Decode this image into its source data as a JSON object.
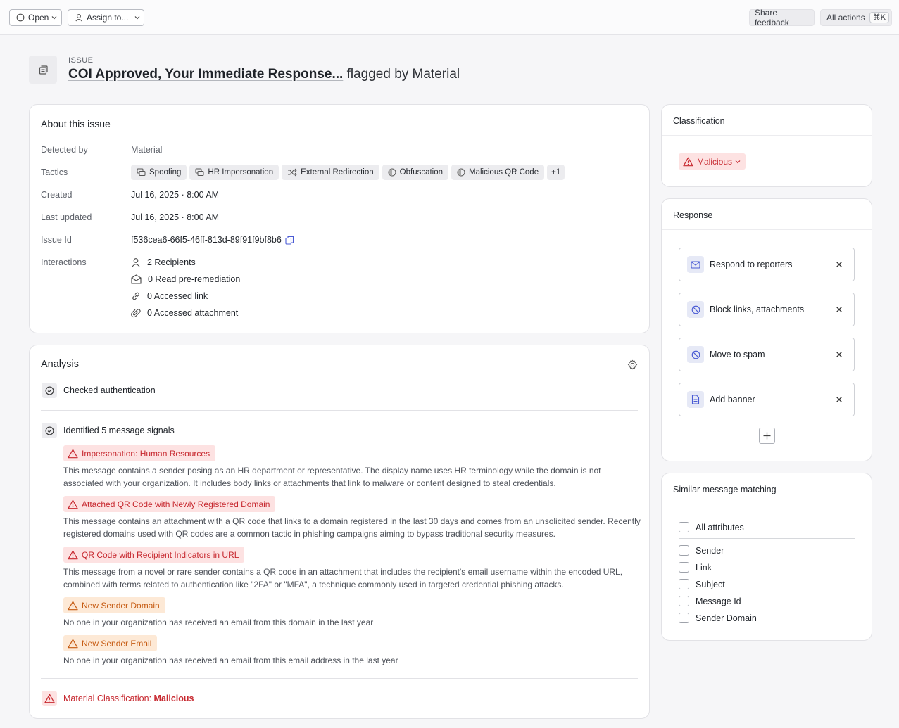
{
  "toolbar": {
    "status_label": "Open",
    "assign_label": "Assign to...",
    "share_feedback_label": "Share feedback",
    "all_actions_label": "All actions",
    "all_actions_shortcut": "⌘K"
  },
  "header": {
    "kicker": "ISSUE",
    "subject": "COI Approved, Your Immediate Response...",
    "flagged_by": "flagged by Material"
  },
  "about": {
    "title": "About this issue",
    "detected_by_label": "Detected by",
    "detected_by_value": "Material",
    "tactics_label": "Tactics",
    "tactics": [
      {
        "label": "Spoofing",
        "icon": "spoof-icon"
      },
      {
        "label": "HR Impersonation",
        "icon": "spoof-icon"
      },
      {
        "label": "External Redirection",
        "icon": "shuffle-icon"
      },
      {
        "label": "Obfuscation",
        "icon": "half-circle-icon"
      },
      {
        "label": "Malicious QR Code",
        "icon": "half-circle-icon"
      }
    ],
    "tactics_more": "+1",
    "created_label": "Created",
    "created_value": "Jul 16, 2025 · 8:00 AM",
    "updated_label": "Last updated",
    "updated_value": "Jul 16, 2025 · 8:00 AM",
    "issue_id_label": "Issue Id",
    "issue_id_value": "f536cea6-66f5-46ff-813d-89f91f9bf8b6",
    "interactions_label": "Interactions",
    "interactions": [
      {
        "label": "2 Recipients",
        "icon": "person-icon"
      },
      {
        "label": "0 Read pre-remediation",
        "icon": "envelope-open-icon"
      },
      {
        "label": "0 Accessed link",
        "icon": "link-icon"
      },
      {
        "label": "0 Accessed attachment",
        "icon": "paperclip-icon"
      }
    ]
  },
  "analysis": {
    "title": "Analysis",
    "step1": "Checked authentication",
    "step2": "Identified 5 message signals",
    "signals": [
      {
        "label": "Impersonation: Human Resources",
        "severity": "red",
        "desc": "This message contains a sender posing as an HR department or representative. The display name uses HR terminology while the domain is not associated with your organization. It includes body links or attachments that link to malware or content designed to steal credentials."
      },
      {
        "label": "Attached QR Code with Newly Registered Domain",
        "severity": "red",
        "desc": "This message contains an attachment with a QR code that links to a domain registered in the last 30 days and comes from an unsolicited sender. Recently registered domains used with QR codes are a common tactic in phishing campaigns aiming to bypass traditional security measures."
      },
      {
        "label": "QR Code with Recipient Indicators in URL",
        "severity": "red",
        "desc": "This message from a novel or rare sender contains a QR code in an attachment that includes the recipient's email username within the encoded URL, combined with terms related to authentication like \"2FA\" or \"MFA\", a technique commonly used in targeted credential phishing attacks."
      },
      {
        "label": "New Sender Domain",
        "severity": "orange",
        "desc": "No one in your organization has received an email from this domain in the last year"
      },
      {
        "label": "New Sender Email",
        "severity": "orange",
        "desc": "No one in your organization has received an email from this email address in the last year"
      }
    ],
    "classification_prefix": "Material Classification:",
    "classification_value": "Malicious"
  },
  "classification": {
    "title": "Classification",
    "value": "Malicious"
  },
  "response": {
    "title": "Response",
    "items": [
      {
        "label": "Respond to reporters",
        "icon": "envelope-icon"
      },
      {
        "label": "Block links, attachments",
        "icon": "block-icon"
      },
      {
        "label": "Move to spam",
        "icon": "block-icon"
      },
      {
        "label": "Add banner",
        "icon": "document-icon"
      }
    ]
  },
  "similar": {
    "title": "Similar message matching",
    "all_label": "All attributes",
    "options": [
      "Sender",
      "Link",
      "Subject",
      "Message Id",
      "Sender Domain"
    ]
  },
  "colors": {
    "danger": "#c7282f",
    "danger_bg": "#fde2e2",
    "warning": "#c55a11",
    "warning_bg": "#fde9d6",
    "response_icon": "#4a5bd4"
  }
}
